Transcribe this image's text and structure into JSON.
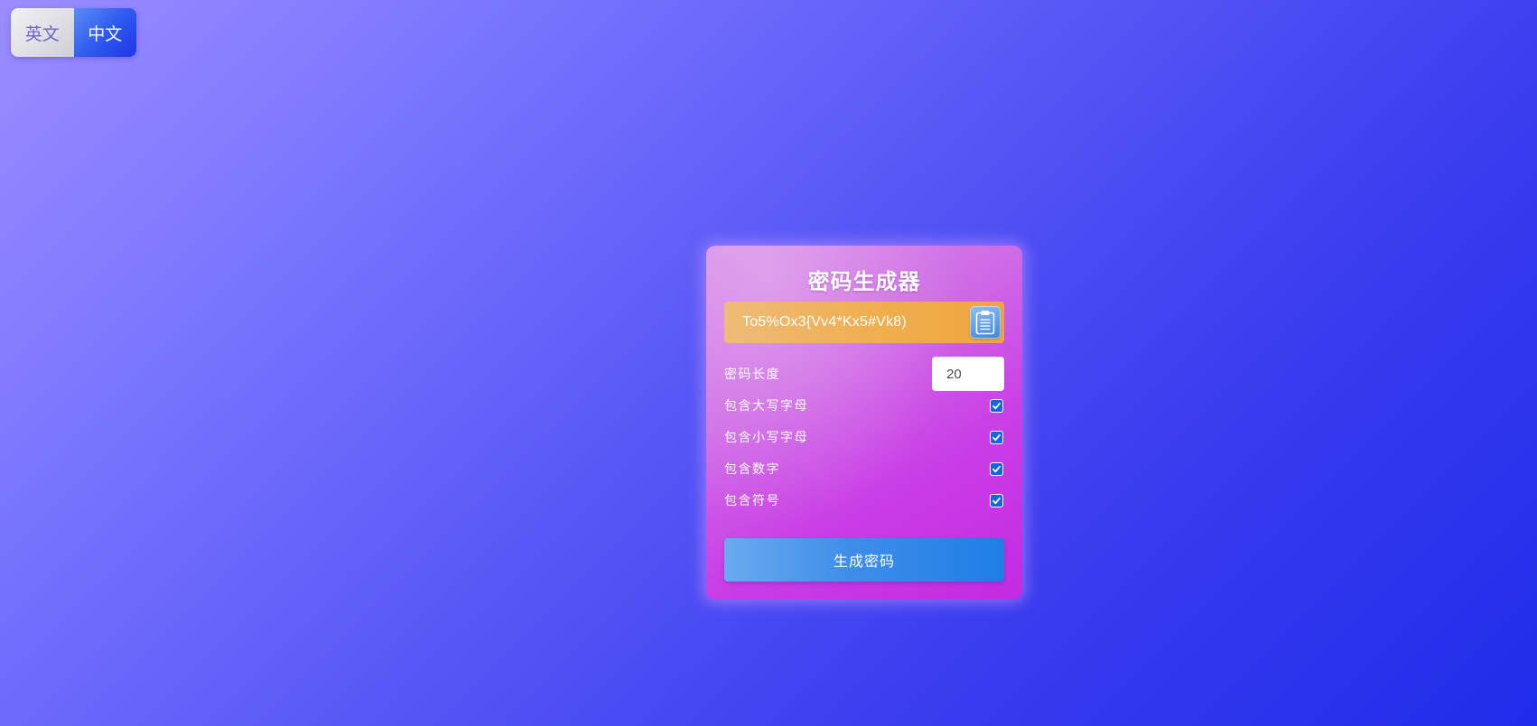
{
  "language_switcher": {
    "english_label": "英文",
    "chinese_label": "中文",
    "active": "中文"
  },
  "generator": {
    "title": "密码生成器",
    "password": "To5%Ox3{Vv4*Kx5#Vk8)",
    "copy_icon": "clipboard-icon",
    "length_label": "密码长度",
    "length_value": "20",
    "options": [
      {
        "label": "包含大写字母",
        "checked": true
      },
      {
        "label": "包含小写字母",
        "checked": true
      },
      {
        "label": "包含数字",
        "checked": true
      },
      {
        "label": "包含符号",
        "checked": true
      }
    ],
    "generate_label": "生成密码"
  },
  "colors": {
    "background_start": "#9b8cff",
    "background_end": "#1f2cea",
    "card_accent": "#c93ee6",
    "password_box": "#f0ae4e",
    "checkbox": "#1565e0",
    "button": "#1f7ee6"
  }
}
